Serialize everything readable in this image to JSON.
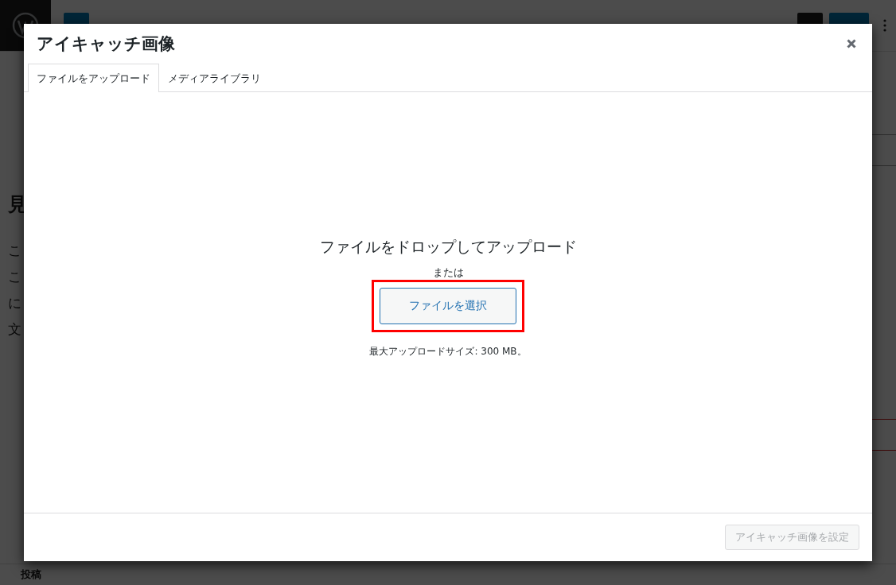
{
  "background": {
    "fragments": [
      {
        "kind": "subheading",
        "text": "見"
      },
      {
        "kind": "body",
        "text": "こ"
      },
      {
        "kind": "body",
        "text": "こ"
      },
      {
        "kind": "body",
        "text": "に"
      },
      {
        "kind": "body",
        "text": "文"
      }
    ],
    "footer_label": "投稿"
  },
  "modal": {
    "title": "アイキャッチ画像",
    "tabs": [
      {
        "label": "ファイルをアップロード",
        "selected": true
      },
      {
        "label": "メディアライブラリ",
        "selected": false
      }
    ],
    "upload": {
      "instructions": "ファイルをドロップしてアップロード",
      "separator": "または",
      "select_button": "ファイルを選択",
      "highlighted": true,
      "max_size": "最大アップロードサイズ: 300 MB。"
    },
    "footer": {
      "button": {
        "label": "アイキャッチ画像を設定",
        "disabled": true
      }
    }
  }
}
